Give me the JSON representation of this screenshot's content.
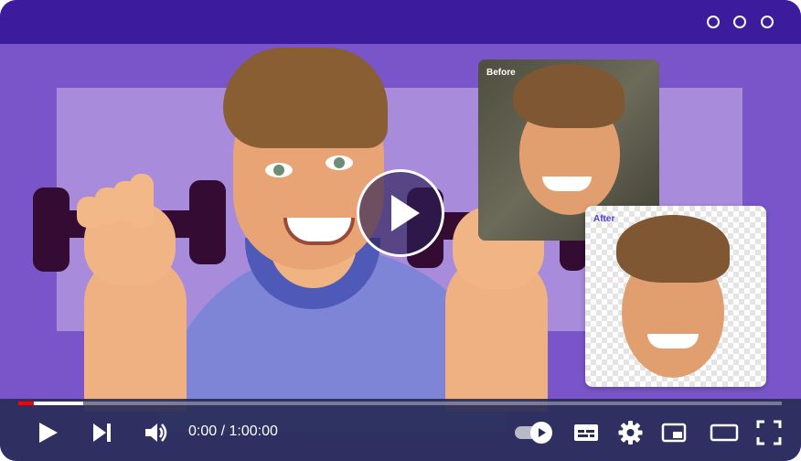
{
  "window": {
    "dots": [
      "dot-1",
      "dot-2",
      "dot-3"
    ],
    "colors": {
      "titlebar": "#3c1c9c",
      "background": "#7a55c9",
      "panel": "#a98bdc"
    }
  },
  "overlay": {
    "before_label": "Before",
    "after_label": "After",
    "before_label_color": "#ffffff",
    "after_label_color": "#4a3bd0"
  },
  "player": {
    "time_display": "0:00 / 1:00:00",
    "progress": {
      "played_fraction": 0.02,
      "buffered_fraction": 0.085
    },
    "icons": [
      "play-icon",
      "skip-next-icon",
      "volume-icon",
      "autoplay-toggle",
      "subtitles-icon",
      "settings-gear-icon",
      "miniplayer-icon",
      "theater-mode-icon",
      "fullscreen-icon"
    ],
    "colors": {
      "played": "#ff0000",
      "bar": "#282d58"
    }
  }
}
